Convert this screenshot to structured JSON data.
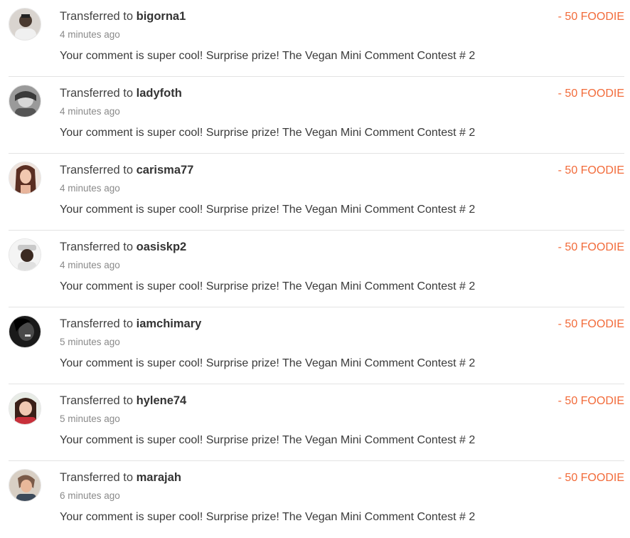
{
  "colors": {
    "amount": "#f26b3a",
    "divider": "#e3e3e3",
    "time": "#8a8a8a"
  },
  "transfers": [
    {
      "prefix": "Transferred to",
      "user": "bigorna1",
      "time": "4 minutes ago",
      "memo": "Your comment is super cool! Surprise prize! The Vegan Mini Comment Contest # 2",
      "amount": "- 50 FOODIE",
      "avatar_icon": "user-avatar-icon"
    },
    {
      "prefix": "Transferred to",
      "user": "ladyfoth",
      "time": "4 minutes ago",
      "memo": "Your comment is super cool! Surprise prize! The Vegan Mini Comment Contest # 2",
      "amount": "- 50 FOODIE",
      "avatar_icon": "user-avatar-icon"
    },
    {
      "prefix": "Transferred to",
      "user": "carisma77",
      "time": "4 minutes ago",
      "memo": "Your comment is super cool! Surprise prize! The Vegan Mini Comment Contest # 2",
      "amount": "- 50 FOODIE",
      "avatar_icon": "user-avatar-icon"
    },
    {
      "prefix": "Transferred to",
      "user": "oasiskp2",
      "time": "4 minutes ago",
      "memo": "Your comment is super cool! Surprise prize! The Vegan Mini Comment Contest # 2",
      "amount": "- 50 FOODIE",
      "avatar_icon": "user-avatar-icon"
    },
    {
      "prefix": "Transferred to",
      "user": "iamchimary",
      "time": "5 minutes ago",
      "memo": "Your comment is super cool! Surprise prize! The Vegan Mini Comment Contest # 2",
      "amount": "- 50 FOODIE",
      "avatar_icon": "user-avatar-icon"
    },
    {
      "prefix": "Transferred to",
      "user": "hylene74",
      "time": "5 minutes ago",
      "memo": "Your comment is super cool! Surprise prize! The Vegan Mini Comment Contest # 2",
      "amount": "- 50 FOODIE",
      "avatar_icon": "user-avatar-icon"
    },
    {
      "prefix": "Transferred to",
      "user": "marajah",
      "time": "6 minutes ago",
      "memo": "Your comment is super cool! Surprise prize! The Vegan Mini Comment Contest # 2",
      "amount": "- 50 FOODIE",
      "avatar_icon": "user-avatar-icon"
    }
  ]
}
